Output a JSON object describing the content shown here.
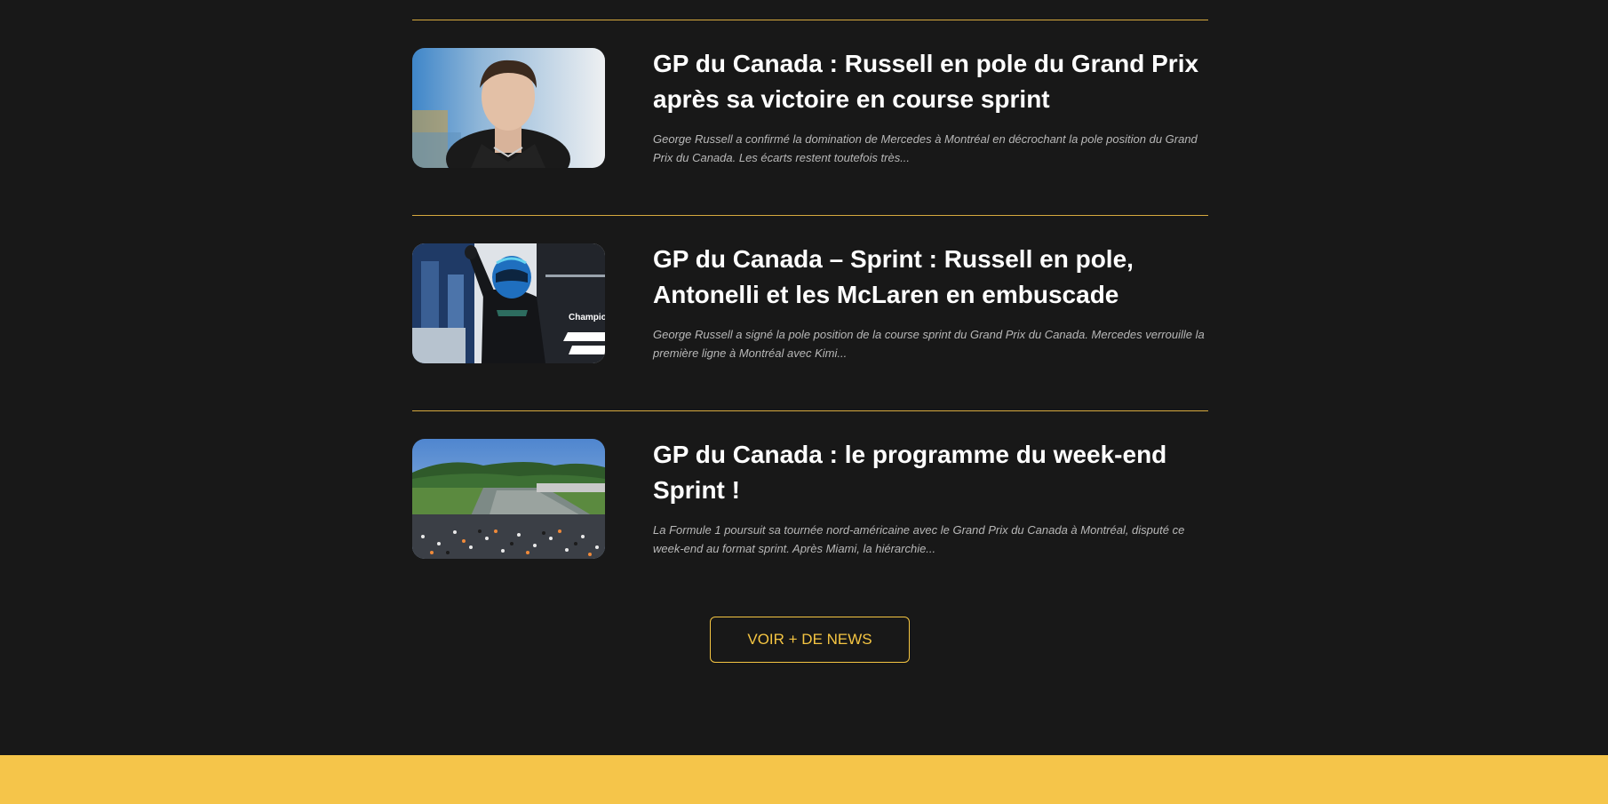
{
  "colors": {
    "background": "#181818",
    "accent": "#f5c542",
    "divider": "#d6a93e",
    "title": "#ffffff",
    "excerpt": "#b8b8b8",
    "footer": "#f5c54a"
  },
  "articles": [
    {
      "title": "GP du Canada : Russell en pole du Grand Prix après sa victoire en course sprint",
      "excerpt": "George Russell a confirmé la domination de Mercedes à Montréal en décrochant la pole position du Grand Prix du Canada. Les écarts restent toutefois très...",
      "image": "driver-portrait"
    },
    {
      "title": "GP du Canada – Sprint : Russell en pole, Antonelli et les McLaren en embuscade",
      "excerpt": "George Russell a signé la pole position de la course sprint du Grand Prix du Canada. Mercedes verrouille la première ligne à Montréal avec Kimi...",
      "image": "driver-waving-podium",
      "image_text": "Champion"
    },
    {
      "title": "GP du Canada : le programme du week-end Sprint !",
      "excerpt": "La Formule 1 poursuit sa tournée nord-américaine avec le Grand Prix du Canada à Montréal, disputé ce week-end au format sprint. Après Miami, la hiérarchie...",
      "image": "circuit-crowd-aerial"
    }
  ],
  "more_button": {
    "label": "VOIR + DE NEWS"
  }
}
